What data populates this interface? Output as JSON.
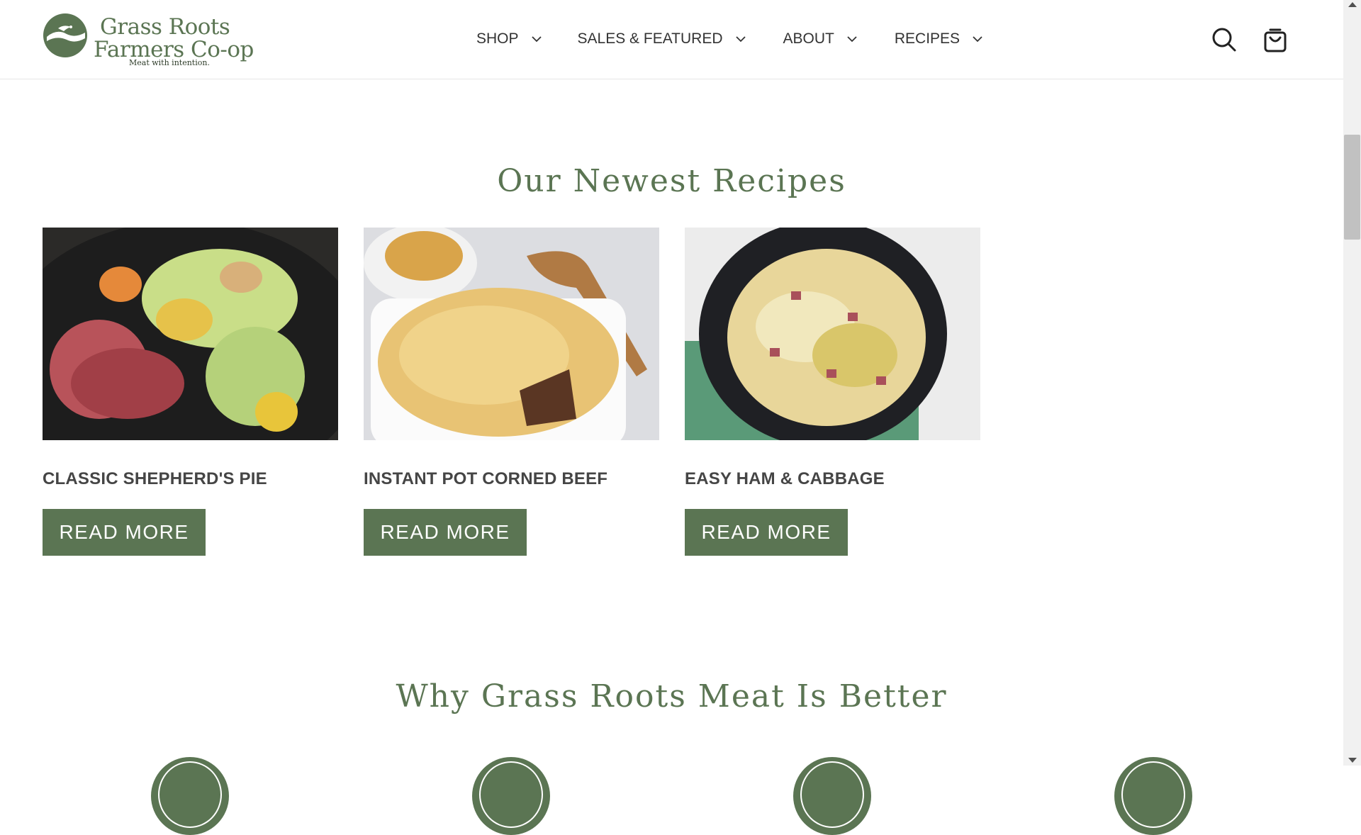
{
  "brand": {
    "name_line1": "Grass Roots",
    "name_line2": "Farmers Co-op",
    "tagline": "Meat with intention.",
    "color": "#5b7553"
  },
  "nav": {
    "items": [
      {
        "label": "SHOP",
        "icon": "chevron-down-icon"
      },
      {
        "label": "SALES & FEATURED",
        "icon": "chevron-down-icon"
      },
      {
        "label": "ABOUT",
        "icon": "chevron-down-icon"
      },
      {
        "label": "RECIPES",
        "icon": "chevron-down-icon"
      }
    ],
    "icons": [
      "search-icon",
      "shopping-bag-icon"
    ]
  },
  "recipes_section": {
    "title": "Our Newest Recipes",
    "cards": [
      {
        "title": "CLASSIC SHEPHERD'S PIE",
        "button": "READ MORE",
        "image": "corned beef with cabbage and potatoes"
      },
      {
        "title": "INSTANT POT CORNED BEEF",
        "button": "READ MORE",
        "image": "shepherd's pie in white baking dish"
      },
      {
        "title": "EASY HAM & CABBAGE",
        "button": "READ MORE",
        "image": "ham and cabbage in dark bowl"
      }
    ]
  },
  "why_section": {
    "title": "Why Grass Roots Meat Is Better"
  }
}
